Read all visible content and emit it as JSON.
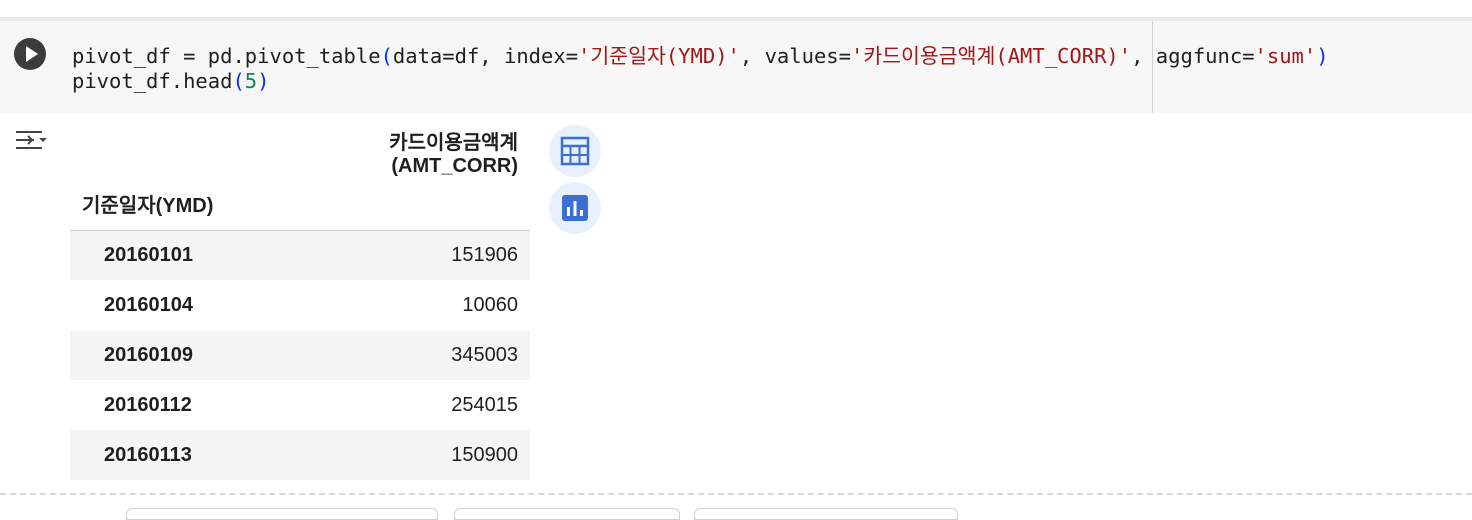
{
  "code": {
    "line1_parts": {
      "a": "pivot_df = pd.pivot_table",
      "b": "(",
      "c": "data=df, index=",
      "d": "'기준일자(YMD)'",
      "e": ", values=",
      "f": "'카드이용금액계(AMT_CORR)'",
      "g": ", aggfunc=",
      "h": "'sum'",
      "i": ")"
    },
    "line2_parts": {
      "a": "pivot_df.head",
      "b": "(",
      "c": "5",
      "d": ")"
    }
  },
  "table": {
    "value_column": "카드이용금액계(AMT_CORR)",
    "index_name": "기준일자(YMD)",
    "rows": [
      {
        "index": "20160101",
        "value": "151906"
      },
      {
        "index": "20160104",
        "value": "10060"
      },
      {
        "index": "20160109",
        "value": "345003"
      },
      {
        "index": "20160112",
        "value": "254015"
      },
      {
        "index": "20160113",
        "value": "150900"
      }
    ]
  },
  "icons": {
    "run": "play-icon",
    "output_menu": "output-collapse-icon",
    "table_view": "table-icon",
    "chart_view": "bar-chart-icon"
  },
  "colors": {
    "accent": "#3b6fd4",
    "string": "#a31515",
    "number": "#098658"
  }
}
